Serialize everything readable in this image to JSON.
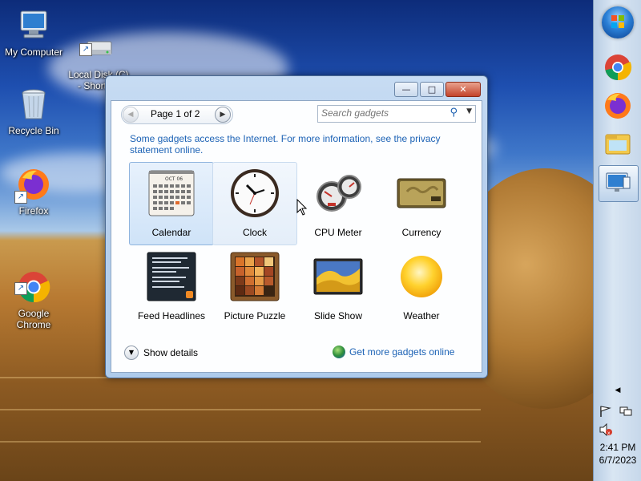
{
  "desktop": {
    "icons": [
      {
        "label": "My Computer",
        "icon": "computer-icon"
      },
      {
        "label": "Local Disk (C)\n- Shortcut",
        "icon": "drive-icon"
      },
      {
        "label": "Recycle Bin",
        "icon": "recycle-bin-icon"
      },
      {
        "label": "Firefox",
        "icon": "firefox-icon"
      },
      {
        "label": "Google\nChrome",
        "icon": "chrome-icon"
      }
    ]
  },
  "taskbar": {
    "items": [
      "start-orb",
      "chrome-icon",
      "firefox-icon",
      "explorer-icon",
      "gadgets-icon"
    ],
    "clock": {
      "time": "2:41 PM",
      "date": "6/7/2023"
    }
  },
  "window": {
    "controls": {
      "minimize": "—",
      "maximize": "□",
      "close": "✕"
    },
    "pager": {
      "label": "Page 1 of 2",
      "prev": "◀",
      "next": "▶"
    },
    "search": {
      "placeholder": "Search gadgets"
    },
    "info_text": "Some gadgets access the Internet.  For more information, see the privacy statement online.",
    "gadgets": [
      {
        "label": "Calendar",
        "state": "selected"
      },
      {
        "label": "Clock",
        "state": "hover"
      },
      {
        "label": "CPU Meter",
        "state": "normal"
      },
      {
        "label": "Currency",
        "state": "normal"
      },
      {
        "label": "Feed Headlines",
        "state": "normal"
      },
      {
        "label": "Picture Puzzle",
        "state": "normal"
      },
      {
        "label": "Slide Show",
        "state": "normal"
      },
      {
        "label": "Weather",
        "state": "normal"
      }
    ],
    "calendar_month": "OCT 06",
    "footer": {
      "details_label": "Show details",
      "more_label": "Get more gadgets online"
    }
  },
  "colors": {
    "link": "#1c62b5",
    "selected_tile": "#cfe3f8",
    "close_button": "#c3432a"
  }
}
